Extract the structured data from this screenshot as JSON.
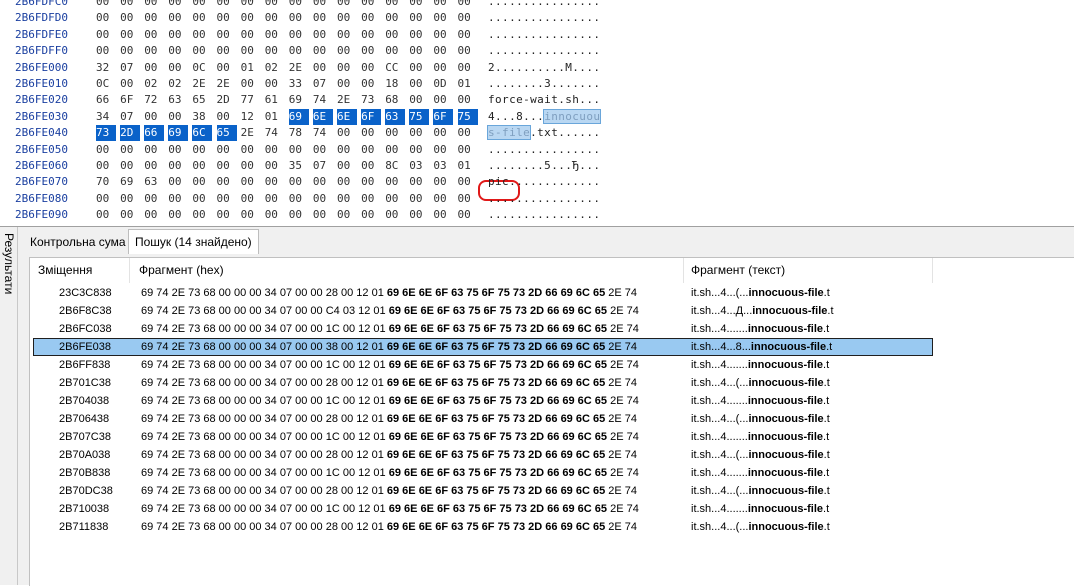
{
  "hex_rows": [
    {
      "addr": "2B6FDFC0",
      "bytes": [
        "00",
        "00",
        "00",
        "00",
        "00",
        "00",
        "00",
        "00",
        "00",
        "00",
        "00",
        "00",
        "00",
        "00",
        "00",
        "00"
      ],
      "ascii": "................",
      "sel": []
    },
    {
      "addr": "2B6FDFD0",
      "bytes": [
        "00",
        "00",
        "00",
        "00",
        "00",
        "00",
        "00",
        "00",
        "00",
        "00",
        "00",
        "00",
        "00",
        "00",
        "00",
        "00"
      ],
      "ascii": "................",
      "sel": []
    },
    {
      "addr": "2B6FDFE0",
      "bytes": [
        "00",
        "00",
        "00",
        "00",
        "00",
        "00",
        "00",
        "00",
        "00",
        "00",
        "00",
        "00",
        "00",
        "00",
        "00",
        "00"
      ],
      "ascii": "................",
      "sel": []
    },
    {
      "addr": "2B6FDFF0",
      "bytes": [
        "00",
        "00",
        "00",
        "00",
        "00",
        "00",
        "00",
        "00",
        "00",
        "00",
        "00",
        "00",
        "00",
        "00",
        "00",
        "00"
      ],
      "ascii": "................",
      "sel": []
    },
    {
      "addr": "2B6FE000",
      "bytes": [
        "32",
        "07",
        "00",
        "00",
        "0C",
        "00",
        "01",
        "02",
        "2E",
        "00",
        "00",
        "00",
        "CC",
        "00",
        "00",
        "00"
      ],
      "ascii": "2..........M....",
      "sel": []
    },
    {
      "addr": "2B6FE010",
      "bytes": [
        "0C",
        "00",
        "02",
        "02",
        "2E",
        "2E",
        "00",
        "00",
        "33",
        "07",
        "00",
        "00",
        "18",
        "00",
        "0D",
        "01"
      ],
      "ascii": "........3.......",
      "sel": []
    },
    {
      "addr": "2B6FE020",
      "bytes": [
        "66",
        "6F",
        "72",
        "63",
        "65",
        "2D",
        "77",
        "61",
        "69",
        "74",
        "2E",
        "73",
        "68",
        "00",
        "00",
        "00"
      ],
      "ascii": "force-wait.sh...",
      "sel": []
    },
    {
      "addr": "2B6FE030",
      "bytes": [
        "34",
        "07",
        "00",
        "00",
        "38",
        "00",
        "12",
        "01",
        "69",
        "6E",
        "6E",
        "6F",
        "63",
        "75",
        "6F",
        "75"
      ],
      "ascii_pre": "4...8...",
      "ascii_hl": "innocuou",
      "ascii_post": "",
      "sel": [
        8,
        9,
        10,
        11,
        12,
        13,
        14,
        15
      ]
    },
    {
      "addr": "2B6FE040",
      "bytes": [
        "73",
        "2D",
        "66",
        "69",
        "6C",
        "65",
        "2E",
        "74",
        "78",
        "74",
        "00",
        "00",
        "00",
        "00",
        "00",
        "00"
      ],
      "ascii_pre": "",
      "ascii_hl": "s-file",
      "ascii_post": ".txt......",
      "sel": [
        0,
        1,
        2,
        3,
        4,
        5
      ]
    },
    {
      "addr": "2B6FE050",
      "bytes": [
        "00",
        "00",
        "00",
        "00",
        "00",
        "00",
        "00",
        "00",
        "00",
        "00",
        "00",
        "00",
        "00",
        "00",
        "00",
        "00"
      ],
      "ascii": "................",
      "sel": []
    },
    {
      "addr": "2B6FE060",
      "bytes": [
        "00",
        "00",
        "00",
        "00",
        "00",
        "00",
        "00",
        "00",
        "35",
        "07",
        "00",
        "00",
        "8C",
        "03",
        "03",
        "01"
      ],
      "ascii": "........5...Ђ...",
      "sel": []
    },
    {
      "addr": "2B6FE070",
      "bytes": [
        "70",
        "69",
        "63",
        "00",
        "00",
        "00",
        "00",
        "00",
        "00",
        "00",
        "00",
        "00",
        "00",
        "00",
        "00",
        "00"
      ],
      "ascii": "pic.............",
      "sel": []
    },
    {
      "addr": "2B6FE080",
      "bytes": [
        "00",
        "00",
        "00",
        "00",
        "00",
        "00",
        "00",
        "00",
        "00",
        "00",
        "00",
        "00",
        "00",
        "00",
        "00",
        "00"
      ],
      "ascii": "................",
      "sel": []
    },
    {
      "addr": "2B6FE090",
      "bytes": [
        "00",
        "00",
        "00",
        "00",
        "00",
        "00",
        "00",
        "00",
        "00",
        "00",
        "00",
        "00",
        "00",
        "00",
        "00",
        "00"
      ],
      "ascii": "................",
      "sel": []
    }
  ],
  "side_tab": {
    "label": "Результати"
  },
  "tabs": [
    {
      "label": "Контрольна сума",
      "active": false
    },
    {
      "label": "Пошук (14 знайдено)",
      "active": true
    }
  ],
  "columns": {
    "offset": "Зміщення",
    "hex": "Фрагмент (hex)",
    "text": "Фрагмент (текст)"
  },
  "results": [
    {
      "offset": "23C3C838",
      "hex_pre": "69 74 2E 73 68 00 00 00 34 07 00 00 28 00 12 01 ",
      "hex_bold": "69 6E 6E 6F 63 75 6F 75 73 2D 66 69 6C 65",
      "hex_post": " 2E 74",
      "text_pre": "it.sh...4...(...",
      "text_bold": "innocuous-file",
      "text_post": ".t",
      "selected": false
    },
    {
      "offset": "2B6F8C38",
      "hex_pre": "69 74 2E 73 68 00 00 00 34 07 00 00 C4 03 12 01 ",
      "hex_bold": "69 6E 6E 6F 63 75 6F 75 73 2D 66 69 6C 65",
      "hex_post": " 2E 74",
      "text_pre": "it.sh...4...Д...",
      "text_bold": "innocuous-file",
      "text_post": ".t",
      "selected": false
    },
    {
      "offset": "2B6FC038",
      "hex_pre": "69 74 2E 73 68 00 00 00 34 07 00 00 1C 00 12 01 ",
      "hex_bold": "69 6E 6E 6F 63 75 6F 75 73 2D 66 69 6C 65",
      "hex_post": " 2E 74",
      "text_pre": "it.sh...4.......",
      "text_bold": "innocuous-file",
      "text_post": ".t",
      "selected": false
    },
    {
      "offset": "2B6FE038",
      "hex_pre": "69 74 2E 73 68 00 00 00 34 07 00 00 38 00 12 01 ",
      "hex_bold": "69 6E 6E 6F 63 75 6F 75 73 2D 66 69 6C 65",
      "hex_post": " 2E 74",
      "text_pre": "it.sh...4...8...",
      "text_bold": "innocuous-file",
      "text_post": ".t",
      "selected": true
    },
    {
      "offset": "2B6FF838",
      "hex_pre": "69 74 2E 73 68 00 00 00 34 07 00 00 1C 00 12 01 ",
      "hex_bold": "69 6E 6E 6F 63 75 6F 75 73 2D 66 69 6C 65",
      "hex_post": " 2E 74",
      "text_pre": "it.sh...4.......",
      "text_bold": "innocuous-file",
      "text_post": ".t",
      "selected": false
    },
    {
      "offset": "2B701C38",
      "hex_pre": "69 74 2E 73 68 00 00 00 34 07 00 00 28 00 12 01 ",
      "hex_bold": "69 6E 6E 6F 63 75 6F 75 73 2D 66 69 6C 65",
      "hex_post": " 2E 74",
      "text_pre": "it.sh...4...(...",
      "text_bold": "innocuous-file",
      "text_post": ".t",
      "selected": false
    },
    {
      "offset": "2B704038",
      "hex_pre": "69 74 2E 73 68 00 00 00 34 07 00 00 1C 00 12 01 ",
      "hex_bold": "69 6E 6E 6F 63 75 6F 75 73 2D 66 69 6C 65",
      "hex_post": " 2E 74",
      "text_pre": "it.sh...4.......",
      "text_bold": "innocuous-file",
      "text_post": ".t",
      "selected": false
    },
    {
      "offset": "2B706438",
      "hex_pre": "69 74 2E 73 68 00 00 00 34 07 00 00 28 00 12 01 ",
      "hex_bold": "69 6E 6E 6F 63 75 6F 75 73 2D 66 69 6C 65",
      "hex_post": " 2E 74",
      "text_pre": "it.sh...4...(...",
      "text_bold": "innocuous-file",
      "text_post": ".t",
      "selected": false
    },
    {
      "offset": "2B707C38",
      "hex_pre": "69 74 2E 73 68 00 00 00 34 07 00 00 1C 00 12 01 ",
      "hex_bold": "69 6E 6E 6F 63 75 6F 75 73 2D 66 69 6C 65",
      "hex_post": " 2E 74",
      "text_pre": "it.sh...4.......",
      "text_bold": "innocuous-file",
      "text_post": ".t",
      "selected": false
    },
    {
      "offset": "2B70A038",
      "hex_pre": "69 74 2E 73 68 00 00 00 34 07 00 00 28 00 12 01 ",
      "hex_bold": "69 6E 6E 6F 63 75 6F 75 73 2D 66 69 6C 65",
      "hex_post": " 2E 74",
      "text_pre": "it.sh...4...(...",
      "text_bold": "innocuous-file",
      "text_post": ".t",
      "selected": false
    },
    {
      "offset": "2B70B838",
      "hex_pre": "69 74 2E 73 68 00 00 00 34 07 00 00 1C 00 12 01 ",
      "hex_bold": "69 6E 6E 6F 63 75 6F 75 73 2D 66 69 6C 65",
      "hex_post": " 2E 74",
      "text_pre": "it.sh...4.......",
      "text_bold": "innocuous-file",
      "text_post": ".t",
      "selected": false
    },
    {
      "offset": "2B70DC38",
      "hex_pre": "69 74 2E 73 68 00 00 00 34 07 00 00 28 00 12 01 ",
      "hex_bold": "69 6E 6E 6F 63 75 6F 75 73 2D 66 69 6C 65",
      "hex_post": " 2E 74",
      "text_pre": "it.sh...4...(...",
      "text_bold": "innocuous-file",
      "text_post": ".t",
      "selected": false
    },
    {
      "offset": "2B710038",
      "hex_pre": "69 74 2E 73 68 00 00 00 34 07 00 00 1C 00 12 01 ",
      "hex_bold": "69 6E 6E 6F 63 75 6F 75 73 2D 66 69 6C 65",
      "hex_post": " 2E 74",
      "text_pre": "it.sh...4.......",
      "text_bold": "innocuous-file",
      "text_post": ".t",
      "selected": false
    },
    {
      "offset": "2B711838",
      "hex_pre": "69 74 2E 73 68 00 00 00 34 07 00 00 28 00 12 01 ",
      "hex_bold": "69 6E 6E 6F 63 75 6F 75 73 2D 66 69 6C 65",
      "hex_post": " 2E 74",
      "text_pre": "it.sh...4...(...",
      "text_bold": "innocuous-file",
      "text_post": ".t",
      "selected": false
    }
  ],
  "colors": {
    "selection": "#0a62c9",
    "row_selected": "#99c9f1",
    "annotation": "#e01818",
    "address": "#1a3fa0"
  }
}
